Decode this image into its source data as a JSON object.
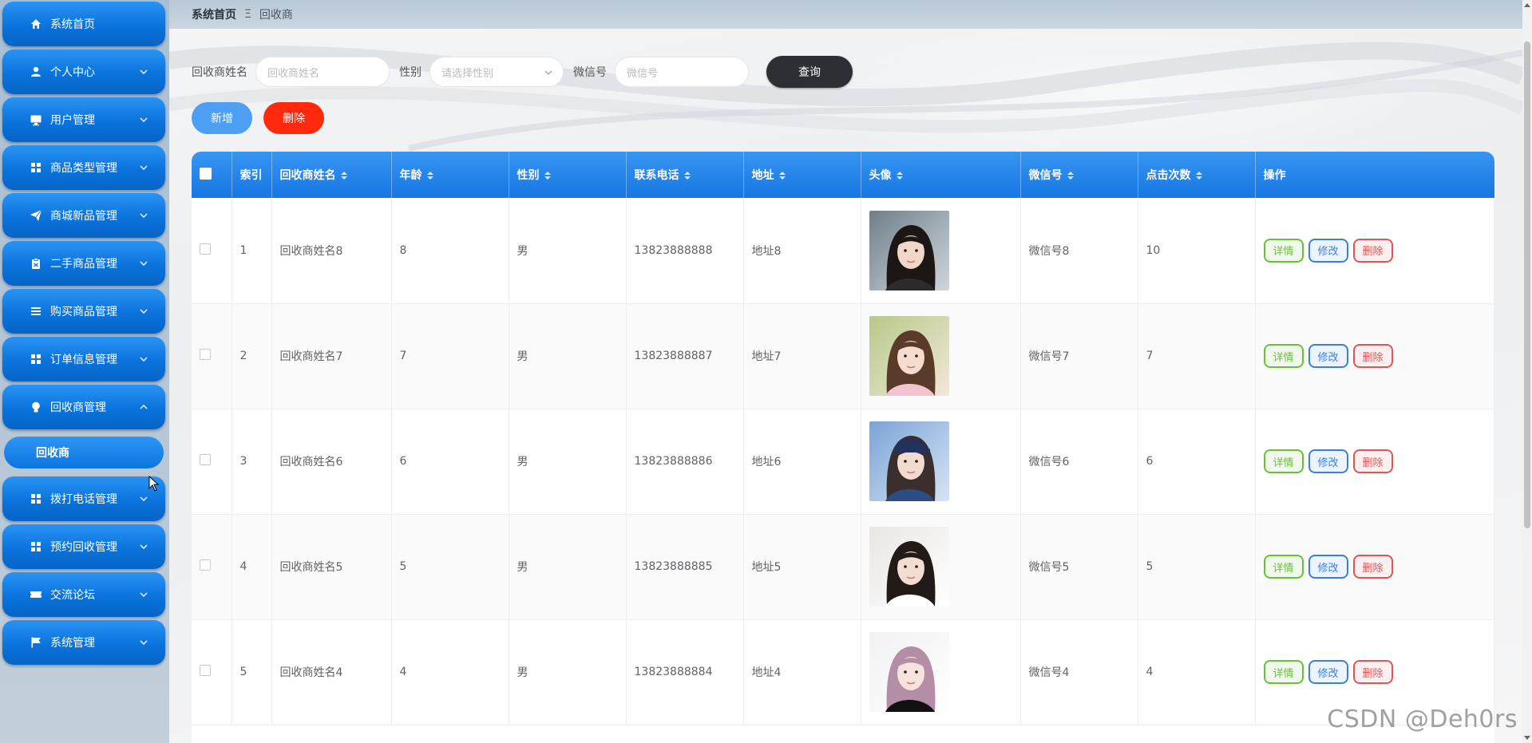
{
  "sidebar": {
    "items": [
      {
        "label": "系统首页",
        "icon": "home-icon",
        "expandable": false
      },
      {
        "label": "个人中心",
        "icon": "user-icon",
        "expandable": true
      },
      {
        "label": "用户管理",
        "icon": "monitor-icon",
        "expandable": true
      },
      {
        "label": "商品类型管理",
        "icon": "grid-icon",
        "expandable": true
      },
      {
        "label": "商城新品管理",
        "icon": "paper-plane-icon",
        "expandable": true
      },
      {
        "label": "二手商品管理",
        "icon": "clipboard-icon",
        "expandable": true
      },
      {
        "label": "购买商品管理",
        "icon": "list-icon",
        "expandable": true
      },
      {
        "label": "订单信息管理",
        "icon": "grid-icon",
        "expandable": true
      },
      {
        "label": "回收商管理",
        "icon": "lightbulb-icon",
        "expandable": true,
        "expanded": true
      },
      {
        "label": "拨打电话管理",
        "icon": "grid-icon",
        "expandable": true
      },
      {
        "label": "预约回收管理",
        "icon": "grid-icon",
        "expandable": true
      },
      {
        "label": "交流论坛",
        "icon": "ticket-icon",
        "expandable": true
      },
      {
        "label": "系统管理",
        "icon": "flag-icon",
        "expandable": true
      }
    ],
    "active_sub_item": "回收商"
  },
  "breadcrumb": {
    "home": "系统首页",
    "separator": "Ξ",
    "current": "回收商"
  },
  "search": {
    "name_label": "回收商姓名",
    "name_placeholder": "回收商姓名",
    "gender_label": "性别",
    "gender_placeholder": "请选择性别",
    "wechat_label": "微信号",
    "wechat_placeholder": "微信号",
    "query_button": "查询"
  },
  "actions": {
    "add_button": "新增",
    "delete_button": "删除"
  },
  "table": {
    "headers": [
      "索引",
      "回收商姓名",
      "年龄",
      "性别",
      "联系电话",
      "地址",
      "头像",
      "微信号",
      "点击次数",
      "操作"
    ],
    "sortable": [
      false,
      true,
      true,
      true,
      true,
      true,
      true,
      true,
      true,
      false
    ],
    "rows": [
      {
        "index": "1",
        "name": "回收商姓名8",
        "age": "8",
        "gender": "男",
        "phone": "13823888888",
        "address": "地址8",
        "wechat": "微信号8",
        "clicks": "10"
      },
      {
        "index": "2",
        "name": "回收商姓名7",
        "age": "7",
        "gender": "男",
        "phone": "13823888887",
        "address": "地址7",
        "wechat": "微信号7",
        "clicks": "7"
      },
      {
        "index": "3",
        "name": "回收商姓名6",
        "age": "6",
        "gender": "男",
        "phone": "13823888886",
        "address": "地址6",
        "wechat": "微信号6",
        "clicks": "6"
      },
      {
        "index": "4",
        "name": "回收商姓名5",
        "age": "5",
        "gender": "男",
        "phone": "13823888885",
        "address": "地址5",
        "wechat": "微信号5",
        "clicks": "5"
      },
      {
        "index": "5",
        "name": "回收商姓名4",
        "age": "4",
        "gender": "男",
        "phone": "13823888884",
        "address": "地址4",
        "wechat": "微信号4",
        "clicks": "4"
      }
    ],
    "row_buttons": {
      "detail": "详情",
      "edit": "修改",
      "delete": "删除"
    }
  },
  "watermark": "CSDN @Deh0rs",
  "colors": {
    "sidebar_button": "#0a73dc",
    "header_blue": "#1677e3",
    "query_button": "#2c2f33",
    "add_button": "#4c9ff3",
    "delete_button": "#ff2a0d",
    "detail_green": "#67c23a",
    "edit_blue": "#3a7ee0",
    "remove_red": "#e05555"
  }
}
